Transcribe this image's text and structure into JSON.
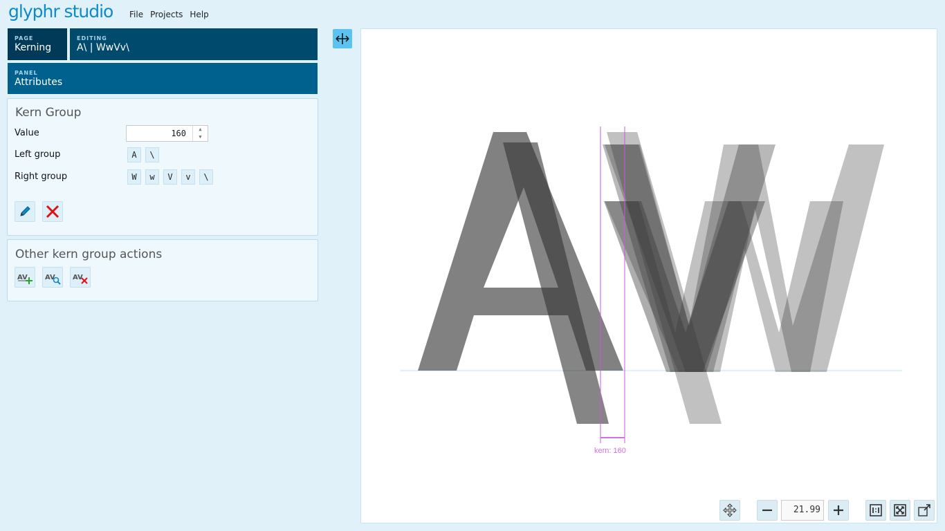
{
  "app": {
    "logo": "glyphr studio"
  },
  "menu": [
    "File",
    "Projects",
    "Help"
  ],
  "nav": {
    "page_caption": "PAGE",
    "page_value": "Kerning",
    "editing_caption": "EDITING",
    "editing_value": "A\\ | WwVv\\",
    "panel_caption": "PANEL",
    "panel_value": "Attributes"
  },
  "kern_group": {
    "title": "Kern Group",
    "value_label": "Value",
    "value": "160",
    "left_label": "Left group",
    "left_chars": [
      "A",
      "\\"
    ],
    "right_label": "Right group",
    "right_chars": [
      "W",
      "w",
      "V",
      "v",
      "\\"
    ],
    "buttons": [
      "edit-icon",
      "delete-icon"
    ]
  },
  "other_actions": {
    "title": "Other kern group actions",
    "buttons": [
      "add-kern-group-icon",
      "find-kern-group-icon",
      "delete-all-kern-groups-icon"
    ]
  },
  "canvas": {
    "kern_label": "kern: 160",
    "zoom": "21.99",
    "tools": [
      "pan-icon",
      "zoom-out-icon",
      "zoom-in-icon",
      "actual-size-icon",
      "fit-icon",
      "popout-icon"
    ],
    "accent_color": "#d36ee8"
  }
}
